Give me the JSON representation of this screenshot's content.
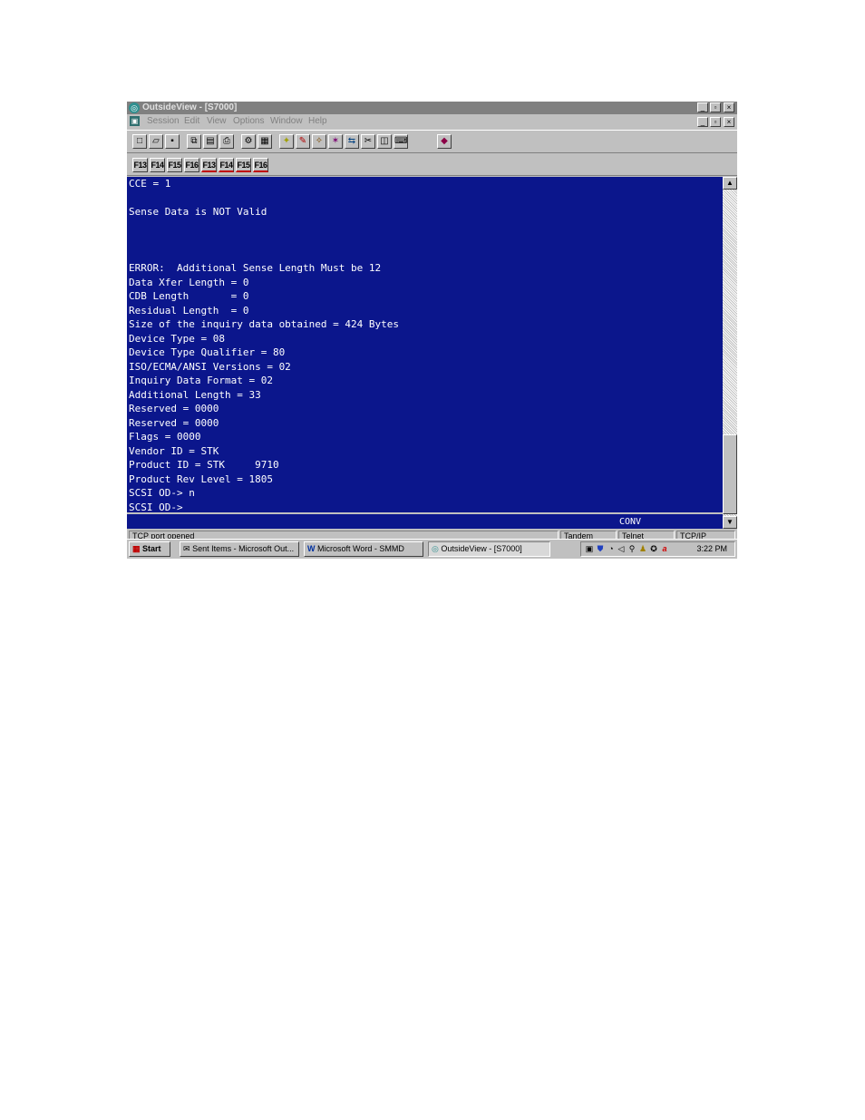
{
  "window": {
    "title": "OutsideView - [S7000]",
    "controls": {
      "minimize": "_",
      "maximize": "▫",
      "close": "×"
    }
  },
  "menu": {
    "items": [
      "Session",
      "Edit",
      "View",
      "Options",
      "Window",
      "Help"
    ]
  },
  "toolbar": {
    "buttons": [
      "new-document-icon",
      "open-folder-icon",
      "save-icon",
      "copy-icon",
      "paste-icon",
      "print-icon",
      "settings-icon",
      "properties-icon",
      "macro-icon",
      "record-icon",
      "play-icon",
      "stop-icon",
      "transfer-icon",
      "scissors-icon",
      "capture-icon",
      "keyboard-icon",
      "help-book-icon"
    ]
  },
  "fkeys": [
    "F13",
    "F14",
    "F15",
    "F16",
    "F13",
    "F14",
    "F15",
    "F16"
  ],
  "terminal": {
    "lines": [
      "CCE = 1",
      "",
      "Sense Data is NOT Valid",
      "",
      "",
      "",
      "ERROR:  Additional Sense Length Must be 12",
      "Data Xfer Length = 0",
      "CDB Length       = 0",
      "Residual Length  = 0",
      "Size of the inquiry data obtained = 424 Bytes",
      "Device Type = 08",
      "Device Type Qualifier = 80",
      "ISO/ECMA/ANSI Versions = 02",
      "Inquiry Data Format = 02",
      "Additional Length = 33",
      "Reserved = 0000",
      "Reserved = 0000",
      "Flags = 0000",
      "Vendor ID = STK",
      "Product ID = STK     9710",
      "Product Rev Level = 1805",
      "SCSI OD-> n",
      "SCSI OD->"
    ],
    "status": "CONV"
  },
  "statusbar": {
    "panels": [
      "TCP port opened",
      "Tandem",
      "Telnet",
      "TCP/IP"
    ]
  },
  "taskbar": {
    "start": "Start",
    "tasks": [
      "Sent Items - Microsoft Out...",
      "Microsoft Word - SMMD",
      "OutsideView - [S7000]"
    ],
    "clock": "3:22 PM"
  }
}
